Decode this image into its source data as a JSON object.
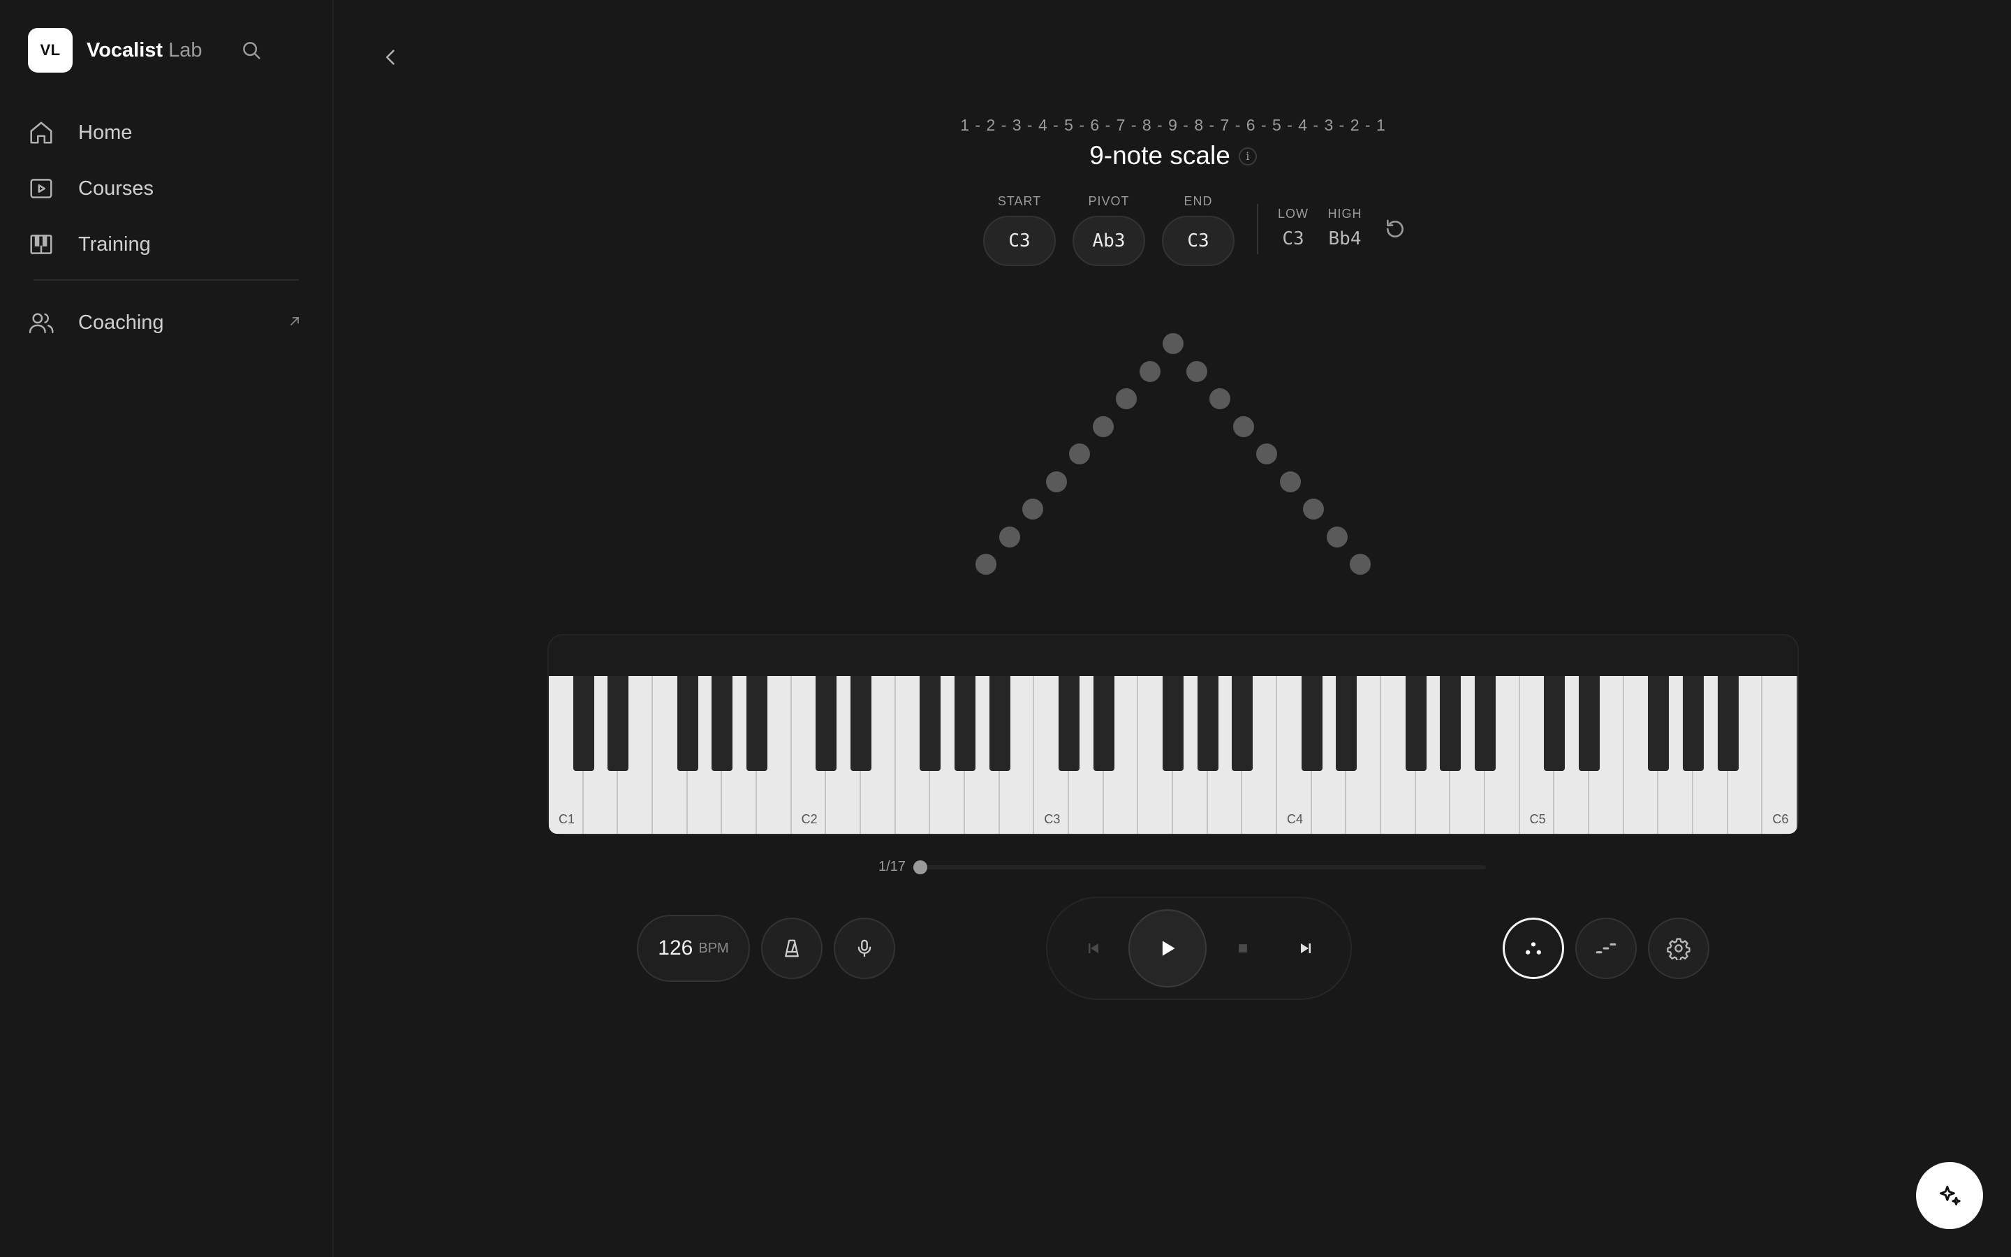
{
  "brand": {
    "logo_text": "VL",
    "name": "Vocalist",
    "suffix": "Lab"
  },
  "sidebar": {
    "items": [
      {
        "label": "Home",
        "icon": "home-icon"
      },
      {
        "label": "Courses",
        "icon": "play-square-icon"
      },
      {
        "label": "Training",
        "icon": "piano-icon"
      }
    ],
    "coaching": {
      "label": "Coaching",
      "icon": "users-icon",
      "external_icon": "arrow-up-right-icon"
    }
  },
  "exercise": {
    "sequence": "1 - 2 - 3 - 4 - 5 - 6 - 7 - 8 - 9 - 8 - 7 - 6 - 5 - 4 - 3 - 2 - 1",
    "title": "9-note scale",
    "info_glyph": "i",
    "start": {
      "label": "START",
      "value": "C3"
    },
    "pivot": {
      "label": "PIVOT",
      "value": "Ab3"
    },
    "end": {
      "label": "END",
      "value": "C3"
    },
    "low": {
      "label": "LOW",
      "value": "C3"
    },
    "high": {
      "label": "HIGH",
      "value": "Bb4"
    },
    "contour_degrees": [
      1,
      2,
      3,
      4,
      5,
      6,
      7,
      8,
      9,
      8,
      7,
      6,
      5,
      4,
      3,
      2,
      1
    ]
  },
  "piano": {
    "octave_labels": [
      "C1",
      "C2",
      "C3",
      "C4",
      "C5",
      "C6"
    ]
  },
  "progress": {
    "label": "1/17",
    "current": 1,
    "total": 17
  },
  "controls": {
    "bpm_value": "126",
    "bpm_unit": "BPM",
    "icons": [
      "metronome-icon",
      "microphone-icon",
      "skip-back-icon",
      "play-icon",
      "stop-icon",
      "skip-forward-icon",
      "dots-view-icon",
      "dashes-view-icon",
      "settings-icon",
      "sparkle-icon"
    ]
  },
  "colors": {
    "background": "#181818",
    "accent": "#ffffff",
    "dot": "#5a5a5a"
  }
}
